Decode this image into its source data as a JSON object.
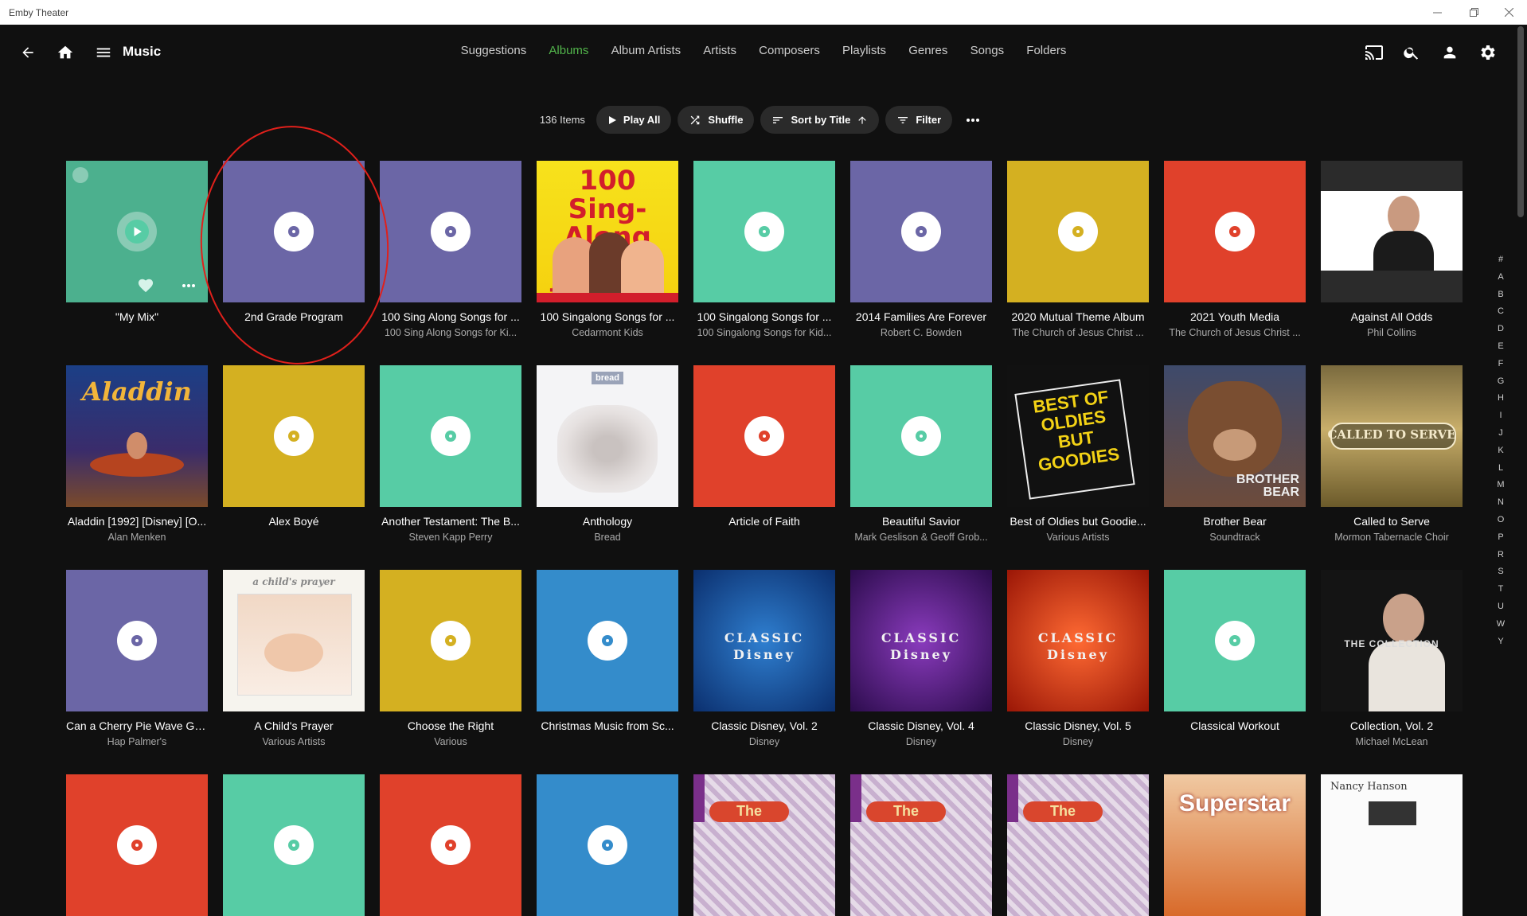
{
  "window": {
    "title": "Emby Theater"
  },
  "header": {
    "title": "Music"
  },
  "nav_tabs": [
    {
      "label": "Suggestions",
      "active": false
    },
    {
      "label": "Albums",
      "active": true
    },
    {
      "label": "Album Artists",
      "active": false
    },
    {
      "label": "Artists",
      "active": false
    },
    {
      "label": "Composers",
      "active": false
    },
    {
      "label": "Playlists",
      "active": false
    },
    {
      "label": "Genres",
      "active": false
    },
    {
      "label": "Songs",
      "active": false
    },
    {
      "label": "Folders",
      "active": false
    }
  ],
  "toolbar": {
    "count": "136 Items",
    "play_all": "Play All",
    "shuffle": "Shuffle",
    "sort": "Sort by Title",
    "filter": "Filter"
  },
  "colors": {
    "accent": "#52b54b",
    "purple": "#6b66a6",
    "teal": "#57cca5",
    "gold": "#d4b021",
    "red": "#e0412b",
    "blue": "#348ccb"
  },
  "albums": [
    {
      "title": "\"My Mix\"",
      "subtitle": "",
      "art": "teal-mix"
    },
    {
      "title": "2nd Grade Program",
      "subtitle": "",
      "art": "purple"
    },
    {
      "title": "100 Sing Along Songs for ...",
      "subtitle": "100 Sing Along Songs for Ki...",
      "art": "purple"
    },
    {
      "title": "100 Singalong Songs for ...",
      "subtitle": "Cedarmont Kids",
      "art": "image",
      "art_label": "100 Sing-Along Songs for kids"
    },
    {
      "title": "100 Singalong Songs for ...",
      "subtitle": "100 Singalong Songs for Kid...",
      "art": "teal"
    },
    {
      "title": "2014 Families Are Forever",
      "subtitle": "Robert C. Bowden",
      "art": "purple"
    },
    {
      "title": "2020 Mutual Theme Album",
      "subtitle": "The Church of Jesus Christ ...",
      "art": "gold"
    },
    {
      "title": "2021 Youth Media",
      "subtitle": "The Church of Jesus Christ ...",
      "art": "red"
    },
    {
      "title": "Against All Odds",
      "subtitle": "Phil Collins",
      "art": "image"
    },
    {
      "title": "Aladdin [1992] [Disney] [O...",
      "subtitle": "Alan Menken",
      "art": "image",
      "art_label": "Aladdin"
    },
    {
      "title": "Alex Boyé",
      "subtitle": "",
      "art": "gold"
    },
    {
      "title": "Another Testament: The B...",
      "subtitle": "Steven Kapp Perry",
      "art": "teal"
    },
    {
      "title": "Anthology",
      "subtitle": "Bread",
      "art": "image",
      "art_label": "bread"
    },
    {
      "title": "Article of Faith",
      "subtitle": "",
      "art": "red"
    },
    {
      "title": "Beautiful Savior",
      "subtitle": "Mark Geslison & Geoff Grob...",
      "art": "teal"
    },
    {
      "title": "Best of Oldies but Goodie...",
      "subtitle": "Various Artists",
      "art": "image",
      "art_label": "BEST OF OLDIES BUT GOODIES"
    },
    {
      "title": "Brother Bear",
      "subtitle": "Soundtrack",
      "art": "image",
      "art_label": "BROTHER BEAR"
    },
    {
      "title": "Called to Serve",
      "subtitle": "Mormon Tabernacle Choir",
      "art": "image",
      "art_label": "CALLED TO SERVE"
    },
    {
      "title": "Can a Cherry Pie Wave Go...",
      "subtitle": "Hap Palmer's",
      "art": "purple"
    },
    {
      "title": "A Child's Prayer",
      "subtitle": "Various Artists",
      "art": "image",
      "art_label": "a child's prayer"
    },
    {
      "title": "Choose the Right",
      "subtitle": "Various",
      "art": "gold"
    },
    {
      "title": "Christmas Music from Sc...",
      "subtitle": "",
      "art": "blue"
    },
    {
      "title": "Classic Disney, Vol. 2",
      "subtitle": "Disney",
      "art": "image",
      "art_label": "CLASSIC Disney"
    },
    {
      "title": "Classic Disney, Vol. 4",
      "subtitle": "Disney",
      "art": "image",
      "art_label": "CLASSIC Disney"
    },
    {
      "title": "Classic Disney, Vol. 5",
      "subtitle": "Disney",
      "art": "image",
      "art_label": "CLASSIC Disney"
    },
    {
      "title": "Classical Workout",
      "subtitle": "",
      "art": "teal"
    },
    {
      "title": "Collection, Vol. 2",
      "subtitle": "Michael McLean",
      "art": "image",
      "art_label": "THE COLLECTION"
    },
    {
      "title": "",
      "subtitle": "",
      "art": "red"
    },
    {
      "title": "",
      "subtitle": "",
      "art": "teal"
    },
    {
      "title": "",
      "subtitle": "",
      "art": "red"
    },
    {
      "title": "",
      "subtitle": "",
      "art": "blue"
    },
    {
      "title": "",
      "subtitle": "",
      "art": "image",
      "art_label": "The"
    },
    {
      "title": "",
      "subtitle": "",
      "art": "image",
      "art_label": "The"
    },
    {
      "title": "",
      "subtitle": "",
      "art": "image",
      "art_label": "The"
    },
    {
      "title": "",
      "subtitle": "",
      "art": "image",
      "art_label": "Superstar"
    },
    {
      "title": "",
      "subtitle": "",
      "art": "image",
      "art_label": "Nancy Hanson"
    }
  ],
  "alphabet": [
    "#",
    "A",
    "B",
    "C",
    "D",
    "E",
    "F",
    "G",
    "H",
    "I",
    "J",
    "K",
    "L",
    "M",
    "N",
    "O",
    "P",
    "R",
    "S",
    "T",
    "U",
    "W",
    "Y"
  ]
}
